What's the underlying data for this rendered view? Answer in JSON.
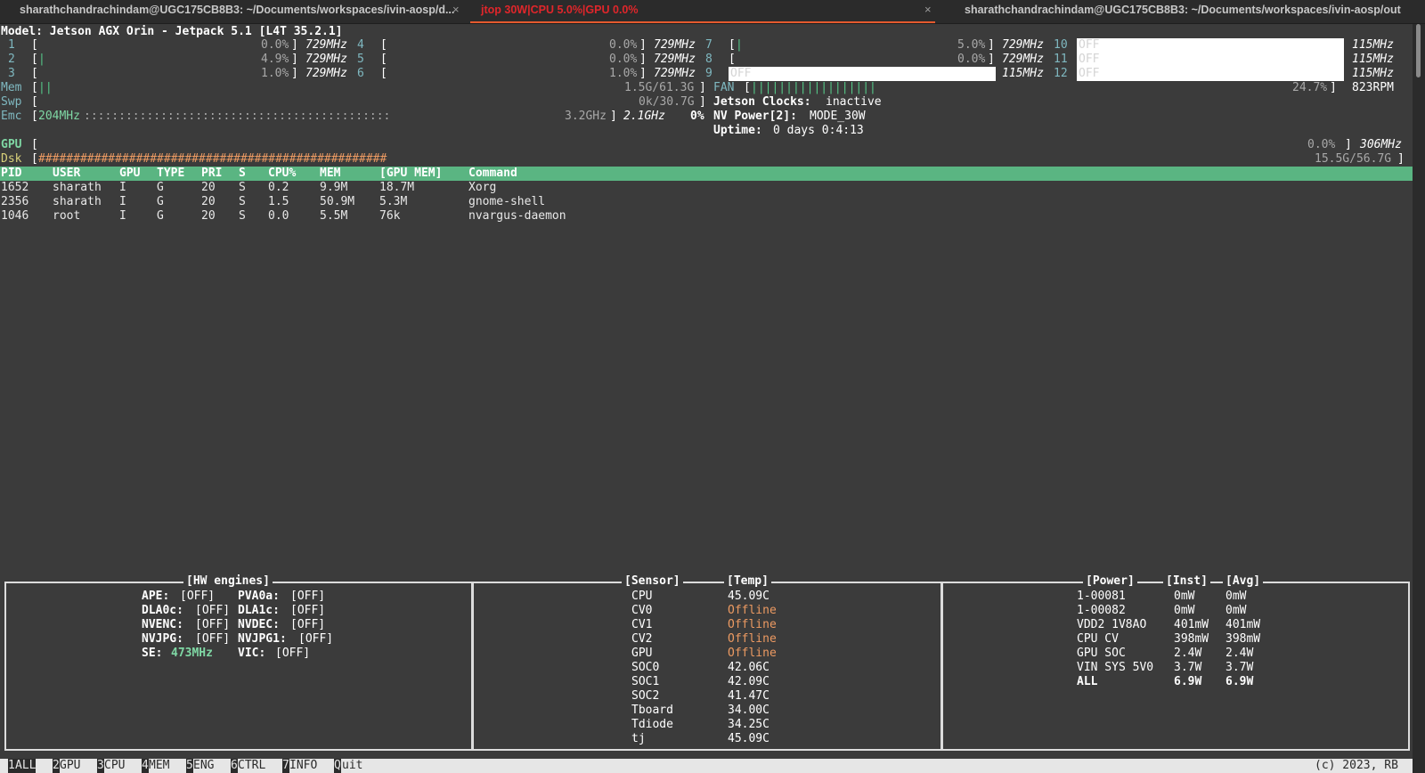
{
  "tabs": [
    {
      "title": "sharathchandrachindam@UGC175CB8B3: ~/Documents/workspaces/ivin-aosp/d...",
      "close": "×"
    },
    {
      "title": "jtop 30W|CPU 5.0%|GPU 0.0%",
      "close": "×"
    },
    {
      "title": "sharathchandrachindam@UGC175CB8B3: ~/Documents/workspaces/ivin-aosp/out",
      "close": ""
    }
  ],
  "model_line": "Model: Jetson AGX Orin - Jetpack 5.1 [L4T 35.2.1]",
  "cpus": [
    {
      "id": "1",
      "bar": "",
      "pct": "0.0%",
      "freq": "729MHz"
    },
    {
      "id": "2",
      "bar": "|",
      "pct": "4.9%",
      "freq": "729MHz"
    },
    {
      "id": "3",
      "bar": "",
      "pct": "1.0%",
      "freq": "729MHz"
    },
    {
      "id": "4",
      "bar": "",
      "pct": "0.0%",
      "freq": "729MHz"
    },
    {
      "id": "5",
      "bar": "",
      "pct": "0.0%",
      "freq": "729MHz"
    },
    {
      "id": "6",
      "bar": "",
      "pct": "1.0%",
      "freq": "729MHz"
    },
    {
      "id": "7",
      "bar": "|",
      "pct": "5.0%",
      "freq": "729MHz"
    },
    {
      "id": "8",
      "bar": "",
      "pct": "0.0%",
      "freq": "729MHz"
    },
    {
      "id": "9",
      "off": "OFF",
      "freq": "115MHz"
    },
    {
      "id": "10",
      "off": "OFF",
      "freq": "115MHz"
    },
    {
      "id": "11",
      "off": "OFF",
      "freq": "115MHz"
    },
    {
      "id": "12",
      "off": "OFF",
      "freq": "115MHz"
    }
  ],
  "mem": {
    "label": "Mem",
    "bar": "||",
    "value": "1.5G/61.3G"
  },
  "swp": {
    "label": "Swp",
    "value": "0k/30.7G"
  },
  "emc": {
    "label": "Emc",
    "freq": "204MHz",
    "dots": "::::::::::::::::::::::::::::::::::::::::::::",
    "max": "3.2GHz",
    "cur": "2.1GHz",
    "pct": "0%"
  },
  "fan": {
    "label": "FAN",
    "bar": "||||||||||||||||||",
    "pct": "24.7%",
    "rpm": "823RPM"
  },
  "clocks": {
    "label": "Jetson Clocks:",
    "value": "inactive"
  },
  "nvpower": {
    "label": "NV Power[2]:",
    "value": "MODE_30W"
  },
  "uptime": {
    "label": "Uptime:",
    "value": "0 days 0:4:13"
  },
  "gpu": {
    "label": "GPU",
    "pct": "0.0%",
    "freq": "306MHz"
  },
  "dsk": {
    "label": "Dsk",
    "bar": "##################################################",
    "value": "15.5G/56.7G"
  },
  "proc_headers": [
    "PID",
    "USER",
    "GPU",
    "TYPE",
    "PRI",
    "S",
    "CPU%",
    "MEM",
    "[GPU MEM]",
    "Command"
  ],
  "procs": [
    [
      "1652",
      "sharath",
      "I",
      "G",
      "20",
      "S",
      "0.2",
      "9.9M",
      "18.7M",
      "Xorg"
    ],
    [
      "2356",
      "sharath",
      "I",
      "G",
      "20",
      "S",
      "1.5",
      "50.9M",
      "5.3M",
      "gnome-shell"
    ],
    [
      "1046",
      "root",
      "I",
      "G",
      "20",
      "S",
      "0.0",
      "5.5M",
      "76k",
      "nvargus-daemon"
    ]
  ],
  "hw_title": "[HW engines]",
  "hw": [
    {
      "k1": "APE:",
      "v1": "[OFF]",
      "k2": "PVA0a:",
      "v2": "[OFF]"
    },
    {
      "k1": "DLA0c:",
      "v1": "[OFF]",
      "k2": "DLA1c:",
      "v2": "[OFF]"
    },
    {
      "k1": "NVENC:",
      "v1": "[OFF]",
      "k2": "NVDEC:",
      "v2": "[OFF]"
    },
    {
      "k1": "NVJPG:",
      "v1": "[OFF]",
      "k2": "NVJPG1:",
      "v2": "[OFF]"
    },
    {
      "k1": "SE:",
      "v1": "473MHz",
      "k2": "VIC:",
      "v2": "[OFF]"
    }
  ],
  "sensor_title": "[Sensor]",
  "temp_title": "[Temp]",
  "sensors": [
    [
      "CPU",
      "45.09C"
    ],
    [
      "CV0",
      "Offline"
    ],
    [
      "CV1",
      "Offline"
    ],
    [
      "CV2",
      "Offline"
    ],
    [
      "GPU",
      "Offline"
    ],
    [
      "SOC0",
      "42.06C"
    ],
    [
      "SOC1",
      "42.09C"
    ],
    [
      "SOC2",
      "41.47C"
    ],
    [
      "Tboard",
      "34.00C"
    ],
    [
      "Tdiode",
      "34.25C"
    ],
    [
      "tj",
      "45.09C"
    ]
  ],
  "power_title": "[Power]",
  "inst_title": "[Inst]",
  "avg_title": "[Avg]",
  "power": [
    [
      "1-00081",
      "0mW",
      "0mW"
    ],
    [
      "1-00082",
      "0mW",
      "0mW"
    ],
    [
      "VDD2 1V8AO",
      "401mW",
      "401mW"
    ],
    [
      "CPU CV",
      "398mW",
      "398mW"
    ],
    [
      "GPU SOC",
      "2.4W",
      "2.4W"
    ],
    [
      "VIN SYS 5V0",
      "3.7W",
      "3.7W"
    ],
    [
      "ALL",
      "6.9W",
      "6.9W"
    ]
  ],
  "footer": [
    {
      "k": "1",
      "l": "ALL"
    },
    {
      "k": "2",
      "l": "GPU"
    },
    {
      "k": "3",
      "l": "CPU"
    },
    {
      "k": "4",
      "l": "MEM"
    },
    {
      "k": "5",
      "l": "ENG"
    },
    {
      "k": "6",
      "l": "CTRL"
    },
    {
      "k": "7",
      "l": "INFO"
    },
    {
      "k": "Q",
      "l": "uit"
    }
  ],
  "copyright": "(c) 2023, RB"
}
